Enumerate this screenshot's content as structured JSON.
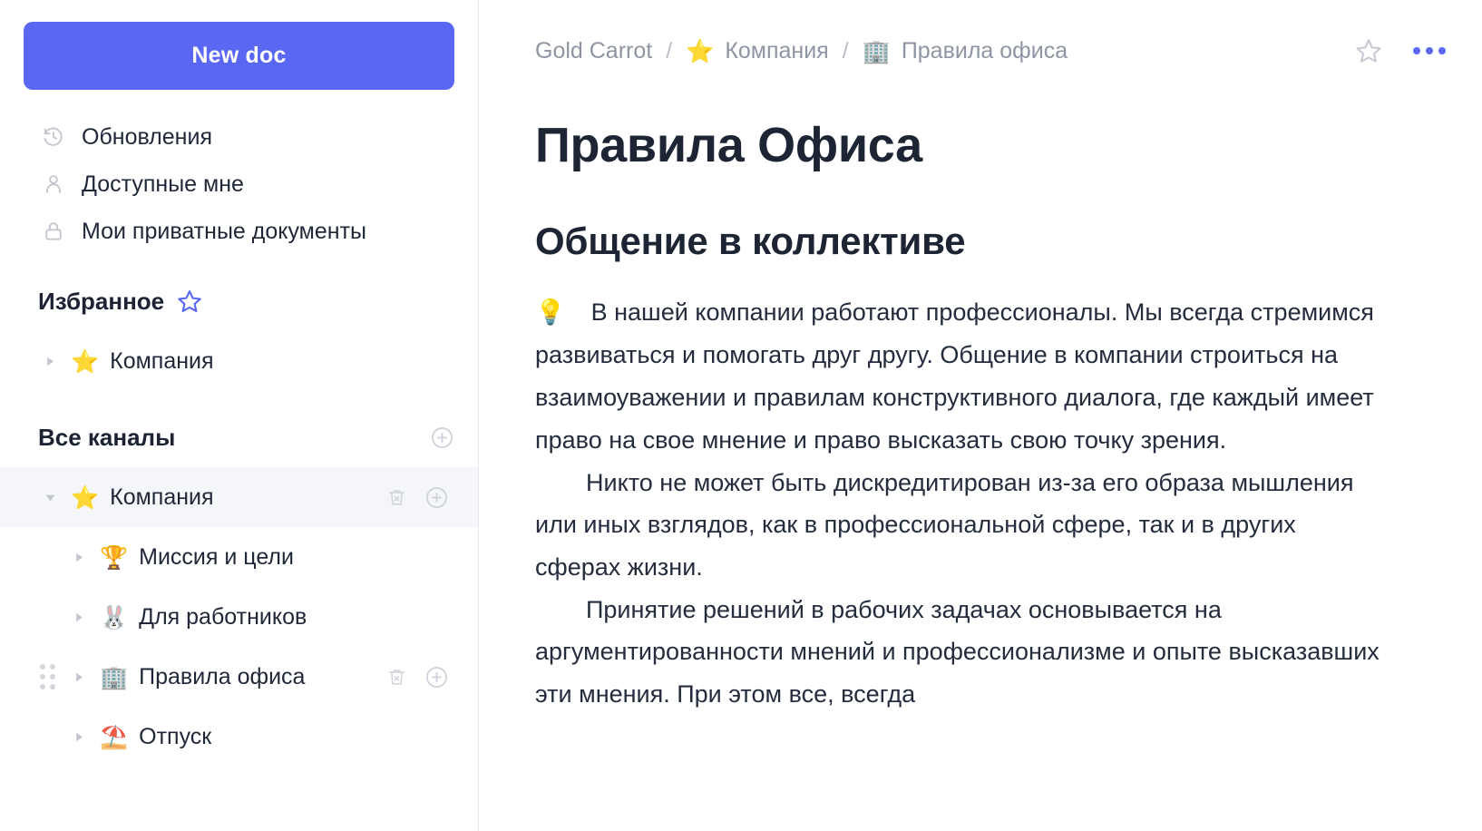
{
  "sidebar": {
    "new_doc_label": "New doc",
    "nav": [
      {
        "label": "Обновления",
        "icon": "history-icon"
      },
      {
        "label": "Доступные мне",
        "icon": "person-icon"
      },
      {
        "label": "Мои приватные документы",
        "icon": "lock-icon"
      }
    ],
    "favorites_section": {
      "title": "Избранное",
      "items": [
        {
          "label": "Компания",
          "emoji": "⭐",
          "expanded": false
        }
      ]
    },
    "channels_section": {
      "title": "Все каналы",
      "items": [
        {
          "label": "Компания",
          "emoji": "⭐",
          "expanded": true,
          "selected": true
        },
        {
          "label": "Миссия и цели",
          "emoji": "🏆",
          "expanded": false
        },
        {
          "label": "Для работников",
          "emoji": "🐰",
          "expanded": false
        },
        {
          "label": "Правила офиса",
          "emoji": "🏢",
          "expanded": false
        },
        {
          "label": "Отпуск",
          "emoji": "⛱️",
          "expanded": false
        }
      ]
    }
  },
  "breadcrumb": {
    "workspace": "Gold Carrot",
    "separator": "/",
    "space_emoji": "⭐",
    "space": "Компания",
    "doc_emoji": "🏢",
    "doc": "Правила офиса"
  },
  "document": {
    "title": "Правила Офиса",
    "heading_1": "Общение в коллективе",
    "callout_emoji": "💡",
    "paragraph_1": "В нашей компании работают профессионалы. Мы всегда стремимся развиваться и помогать друг другу. Общение в компании строиться на взаимоуважении и правилам конструктивного диалога, где каждый имеет право на свое мнение и право высказать свою точку зрения.",
    "paragraph_2": "Никто не может быть дискредитирован из-за его образа мышления или иных взглядов, как в профессиональной сфере, так и в других сферах жизни.",
    "paragraph_3": "Принятие решений в рабочих задачах основывается на аргументированности мнений и профессионализме и опыте высказавших эти мнения. При этом все, всегда"
  },
  "colors": {
    "accent": "#5A67F2",
    "text": "#1D2433",
    "muted": "#8F95A3",
    "selected_row": "#F5F6F9"
  }
}
